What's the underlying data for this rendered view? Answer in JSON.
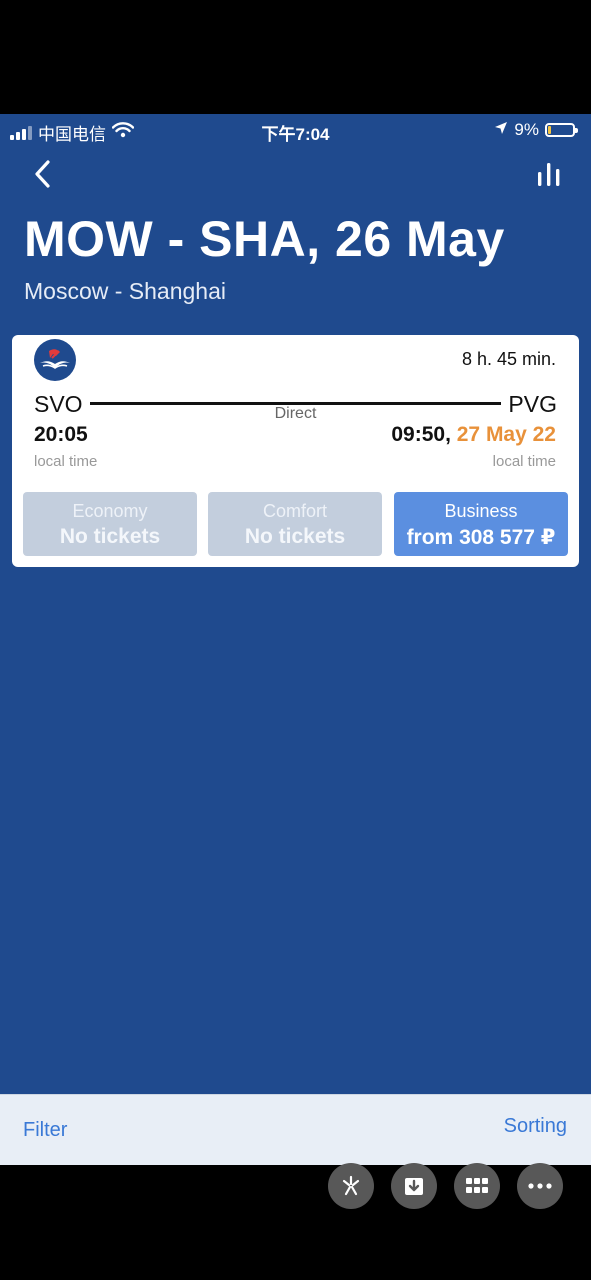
{
  "status_bar": {
    "carrier": "中国电信",
    "time": "下午7:04",
    "battery": "9%",
    "battery_level": 0.09,
    "icons": [
      "signal-icon",
      "wifi-icon",
      "location-arrow-icon",
      "battery-icon"
    ]
  },
  "header": {
    "back_icon": "chevron-left-icon",
    "stats_icon": "bar-chart-icon",
    "title": "MOW - SHA, 26 May",
    "subtitle": "Moscow - Shanghai"
  },
  "flight": {
    "airline_logo": "aeroflot-logo",
    "duration": "8 h. 45 min.",
    "from_code": "SVO",
    "to_code": "PVG",
    "route_type": "Direct",
    "departure_time": "20:05",
    "arrival_time": "09:50,",
    "arrival_date": "27 May 22",
    "departure_local": "local time",
    "arrival_local": "local time",
    "fares": [
      {
        "class": "Economy",
        "price": "No tickets",
        "available": false
      },
      {
        "class": "Comfort",
        "price": "No tickets",
        "available": false
      },
      {
        "class": "Business",
        "price": "from 308 577 ₽",
        "available": true
      }
    ]
  },
  "bottom_bar": {
    "filter_label": "Filter",
    "sorting_label": "Sorting"
  },
  "tools": [
    "sparkle-icon",
    "download-icon",
    "grid-icon",
    "more-icon"
  ],
  "colors": {
    "app_background": "#1f4a8e",
    "accent_orange": "#e8913a",
    "active_fare": "#5b8fe0",
    "disabled_fare": "#c3cedd",
    "link_blue": "#3a79d6"
  }
}
